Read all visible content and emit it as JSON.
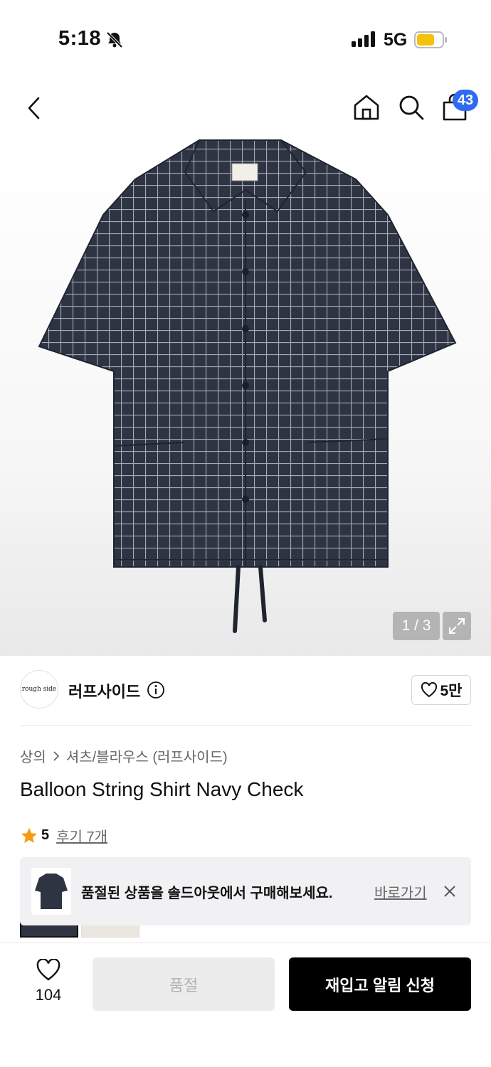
{
  "status": {
    "time": "5:18",
    "network": "5G"
  },
  "nav": {
    "cart_count": "43"
  },
  "hero": {
    "pager": "1 / 3",
    "label_text": "rough side"
  },
  "brand": {
    "logo_text": "rough side",
    "name": "러프사이드",
    "likes": "5만"
  },
  "breadcrumb": {
    "category": "상의",
    "subcategory": "셔츠/블라우스 (러프사이드)"
  },
  "product": {
    "title": "Balloon String Shirt Navy Check"
  },
  "rating": {
    "score": "5",
    "reviews_label": "후기 7개"
  },
  "soldout_banner": {
    "message": "품절된 상품을 솔드아웃에서 구매해보세요.",
    "link": "바로가기"
  },
  "bottom": {
    "wish_count": "104",
    "soldout_label": "품절",
    "restock_label": "재입고 알림 신청"
  },
  "colors": {
    "accent_blue": "#2f6bf2",
    "star": "#f39c12",
    "shirt_navy": "#2e3442"
  }
}
